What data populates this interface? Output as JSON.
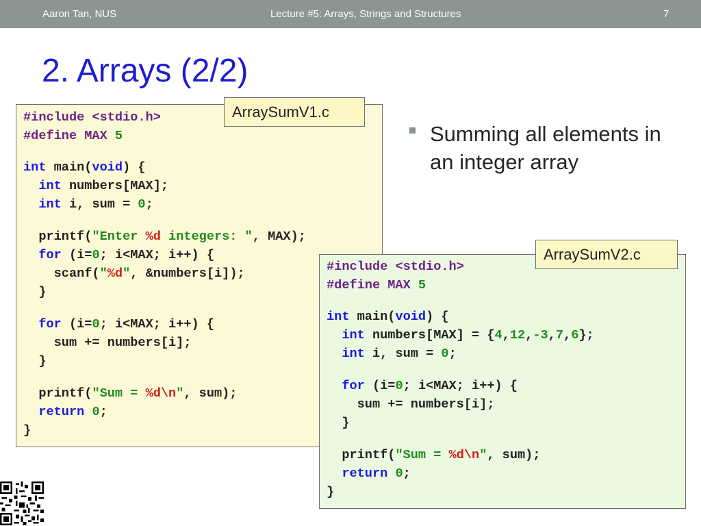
{
  "header": {
    "author": "Aaron Tan, NUS",
    "lecture": "Lecture #5: Arrays, Strings and Structures",
    "page_number": "7"
  },
  "slide": {
    "title": "2. Arrays (2/2)"
  },
  "files": {
    "first": "ArraySumV1.c",
    "second": "ArraySumV2.c"
  },
  "bullet": {
    "text": "Summing all elements in an integer array"
  },
  "code_v1": [
    [
      {
        "t": "#include ",
        "c": "pp"
      },
      {
        "t": "<stdio.h>",
        "c": "pp"
      }
    ],
    [
      {
        "t": "#define ",
        "c": "pp"
      },
      {
        "t": "MAX ",
        "c": "pp"
      },
      {
        "t": "5",
        "c": "num"
      }
    ],
    [
      {
        "t": "int",
        "c": "kw"
      },
      {
        "t": " main(",
        "c": ""
      },
      {
        "t": "void",
        "c": "kw"
      },
      {
        "t": ") {",
        "c": ""
      }
    ],
    [
      {
        "t": "  ",
        "c": ""
      },
      {
        "t": "int",
        "c": "kw"
      },
      {
        "t": " numbers[MAX];",
        "c": ""
      }
    ],
    [
      {
        "t": "  ",
        "c": ""
      },
      {
        "t": "int",
        "c": "kw"
      },
      {
        "t": " i, sum = ",
        "c": ""
      },
      {
        "t": "0",
        "c": "num"
      },
      {
        "t": ";",
        "c": ""
      }
    ],
    [
      {
        "t": "  printf(",
        "c": ""
      },
      {
        "t": "\"Enter ",
        "c": "str"
      },
      {
        "t": "%d",
        "c": "fmt"
      },
      {
        "t": " integers: \"",
        "c": "str"
      },
      {
        "t": ", MAX);",
        "c": ""
      }
    ],
    [
      {
        "t": "  ",
        "c": ""
      },
      {
        "t": "for",
        "c": "kw"
      },
      {
        "t": " (i=",
        "c": ""
      },
      {
        "t": "0",
        "c": "num"
      },
      {
        "t": "; i<MAX; i++) {",
        "c": ""
      }
    ],
    [
      {
        "t": "    scanf(",
        "c": ""
      },
      {
        "t": "\"",
        "c": "str"
      },
      {
        "t": "%d",
        "c": "fmt"
      },
      {
        "t": "\"",
        "c": "str"
      },
      {
        "t": ", &numbers[i]);",
        "c": ""
      }
    ],
    [
      {
        "t": "  }",
        "c": ""
      }
    ],
    [
      {
        "t": "  ",
        "c": ""
      },
      {
        "t": "for",
        "c": "kw"
      },
      {
        "t": " (i=",
        "c": ""
      },
      {
        "t": "0",
        "c": "num"
      },
      {
        "t": "; i<MAX; i++) {",
        "c": ""
      }
    ],
    [
      {
        "t": "    sum += numbers[i];",
        "c": ""
      }
    ],
    [
      {
        "t": "  }",
        "c": ""
      }
    ],
    [
      {
        "t": "  printf(",
        "c": ""
      },
      {
        "t": "\"Sum = ",
        "c": "str"
      },
      {
        "t": "%d\\n",
        "c": "fmt"
      },
      {
        "t": "\"",
        "c": "str"
      },
      {
        "t": ", sum);",
        "c": ""
      }
    ],
    [
      {
        "t": "  ",
        "c": ""
      },
      {
        "t": "return",
        "c": "kw"
      },
      {
        "t": " ",
        "c": ""
      },
      {
        "t": "0",
        "c": "num"
      },
      {
        "t": ";",
        "c": ""
      }
    ],
    [
      {
        "t": "}",
        "c": ""
      }
    ]
  ],
  "code_v2": [
    [
      {
        "t": "#include ",
        "c": "pp"
      },
      {
        "t": "<stdio.h>",
        "c": "pp"
      }
    ],
    [
      {
        "t": "#define ",
        "c": "pp"
      },
      {
        "t": "MAX ",
        "c": "pp"
      },
      {
        "t": "5",
        "c": "num"
      }
    ],
    [
      {
        "t": "int",
        "c": "kw"
      },
      {
        "t": " main(",
        "c": ""
      },
      {
        "t": "void",
        "c": "kw"
      },
      {
        "t": ") {",
        "c": ""
      }
    ],
    [
      {
        "t": "  ",
        "c": ""
      },
      {
        "t": "int",
        "c": "kw"
      },
      {
        "t": " numbers[MAX] = {",
        "c": ""
      },
      {
        "t": "4",
        "c": "num"
      },
      {
        "t": ",",
        "c": ""
      },
      {
        "t": "12",
        "c": "num"
      },
      {
        "t": ",",
        "c": ""
      },
      {
        "t": "-3",
        "c": "num"
      },
      {
        "t": ",",
        "c": ""
      },
      {
        "t": "7",
        "c": "num"
      },
      {
        "t": ",",
        "c": ""
      },
      {
        "t": "6",
        "c": "num"
      },
      {
        "t": "};",
        "c": ""
      }
    ],
    [
      {
        "t": "  ",
        "c": ""
      },
      {
        "t": "int",
        "c": "kw"
      },
      {
        "t": " i, sum = ",
        "c": ""
      },
      {
        "t": "0",
        "c": "num"
      },
      {
        "t": ";",
        "c": ""
      }
    ],
    [
      {
        "t": "  ",
        "c": ""
      },
      {
        "t": "for",
        "c": "kw"
      },
      {
        "t": " (i=",
        "c": ""
      },
      {
        "t": "0",
        "c": "num"
      },
      {
        "t": "; i<MAX; i++) {",
        "c": ""
      }
    ],
    [
      {
        "t": "    sum += numbers[i];",
        "c": ""
      }
    ],
    [
      {
        "t": "  }",
        "c": ""
      }
    ],
    [
      {
        "t": "  printf(",
        "c": ""
      },
      {
        "t": "\"Sum = ",
        "c": "str"
      },
      {
        "t": "%d\\n",
        "c": "fmt"
      },
      {
        "t": "\"",
        "c": "str"
      },
      {
        "t": ", sum);",
        "c": ""
      }
    ],
    [
      {
        "t": "  ",
        "c": ""
      },
      {
        "t": "return",
        "c": "kw"
      },
      {
        "t": " ",
        "c": ""
      },
      {
        "t": "0",
        "c": "num"
      },
      {
        "t": ";",
        "c": ""
      }
    ],
    [
      {
        "t": "}",
        "c": ""
      }
    ]
  ],
  "colors": {
    "header_bg": "#8c9590",
    "title": "#1c1cd0",
    "keyword": "#1a1ae0",
    "preprocessor": "#6d2389",
    "number_string": "#1f8a1f",
    "format_spec": "#d01f1f",
    "box1_bg": "#fcf9d6",
    "box2_bg": "#ebf9e0"
  },
  "icons": {
    "qr": "qr-code-icon"
  }
}
